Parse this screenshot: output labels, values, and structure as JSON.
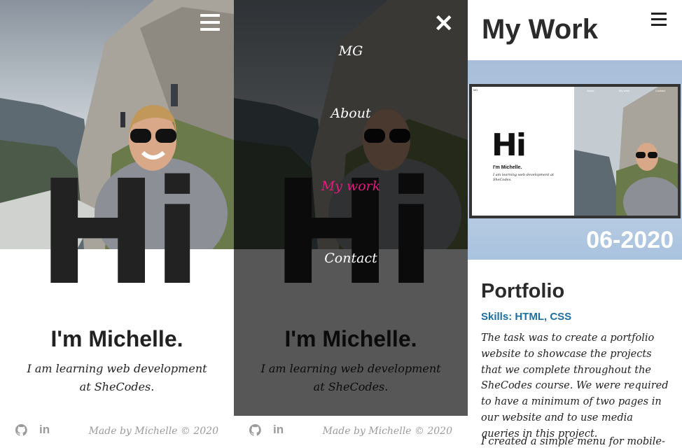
{
  "hero": {
    "greeting": "Hi",
    "name": "I'm Michelle.",
    "subtitle": "I am learning web development at SheCodes."
  },
  "footer": {
    "github_icon": "github-icon",
    "linkedin_label": "in",
    "credit": "Made by Michelle © 2020"
  },
  "menu": {
    "close_label": "✕",
    "items": [
      {
        "label": "MG"
      },
      {
        "label": "About"
      },
      {
        "label": "My work",
        "active": true
      },
      {
        "label": "Contact"
      }
    ],
    "active_color": "#e6197e"
  },
  "work_page": {
    "title": "My Work",
    "thumbnail": {
      "logo": "MG",
      "nav": [
        "About",
        "My work",
        "Contact"
      ],
      "greeting": "Hi",
      "name": "I'm Michelle.",
      "subtitle": "I am learning web development at SheCodes."
    },
    "date": "06-2020",
    "project_title": "Portfolio",
    "skills": "Skills: HTML, CSS",
    "description": "The task was to create a portfolio website to showcase the projects that we complete throughout the SheCodes course. We were required to have a minimum of two pages in our website and to use media queries in this project.",
    "description_2": "I created a simple menu for mobile-"
  },
  "colors": {
    "text_dark": "#222222",
    "skills_blue": "#1b6fa3",
    "footer_gray": "#9a9a9a"
  }
}
